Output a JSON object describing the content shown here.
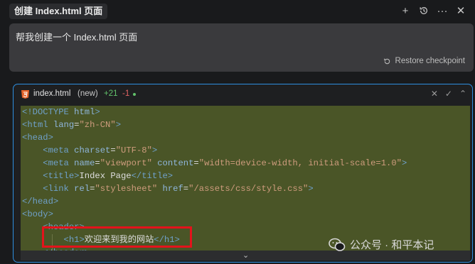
{
  "header": {
    "tab_title": "创建 Index.html 页面",
    "actions": [
      "plus-icon",
      "history-icon",
      "more-icon",
      "close-icon"
    ]
  },
  "prompt": {
    "text": "帮我创建一个 Index.html 页面",
    "restore_label": "Restore checkpoint"
  },
  "file": {
    "name": "index.html",
    "status": "(new)",
    "added": "+21",
    "removed": "-1"
  },
  "code_lines": [
    [
      {
        "c": "tg",
        "t": "<!DOCTYPE "
      },
      {
        "c": "attr",
        "t": "html"
      },
      {
        "c": "tg",
        "t": ">"
      }
    ],
    [
      {
        "c": "tg",
        "t": "<html "
      },
      {
        "c": "attr",
        "t": "lang"
      },
      {
        "c": "txt",
        "t": "="
      },
      {
        "c": "str",
        "t": "\"zh-CN\""
      },
      {
        "c": "tg",
        "t": ">"
      }
    ],
    [
      {
        "c": "tg",
        "t": "<head>"
      }
    ],
    [
      {
        "c": "txt",
        "t": "    "
      },
      {
        "c": "tg",
        "t": "<meta "
      },
      {
        "c": "attr",
        "t": "charset"
      },
      {
        "c": "txt",
        "t": "="
      },
      {
        "c": "str",
        "t": "\"UTF-8\""
      },
      {
        "c": "tg",
        "t": ">"
      }
    ],
    [
      {
        "c": "txt",
        "t": "    "
      },
      {
        "c": "tg",
        "t": "<meta "
      },
      {
        "c": "attr",
        "t": "name"
      },
      {
        "c": "txt",
        "t": "="
      },
      {
        "c": "str",
        "t": "\"viewport\""
      },
      {
        "c": "txt",
        "t": " "
      },
      {
        "c": "attr",
        "t": "content"
      },
      {
        "c": "txt",
        "t": "="
      },
      {
        "c": "str",
        "t": "\"width=device-width, initial-scale=1.0\""
      },
      {
        "c": "tg",
        "t": ">"
      }
    ],
    [
      {
        "c": "txt",
        "t": "    "
      },
      {
        "c": "tg",
        "t": "<title>"
      },
      {
        "c": "txt",
        "t": "Index Page"
      },
      {
        "c": "tg",
        "t": "</title>"
      }
    ],
    [
      {
        "c": "txt",
        "t": "    "
      },
      {
        "c": "tg",
        "t": "<link "
      },
      {
        "c": "attr",
        "t": "rel"
      },
      {
        "c": "txt",
        "t": "="
      },
      {
        "c": "str",
        "t": "\"stylesheet\""
      },
      {
        "c": "txt",
        "t": " "
      },
      {
        "c": "attr",
        "t": "href"
      },
      {
        "c": "txt",
        "t": "="
      },
      {
        "c": "str",
        "t": "\"/assets/css/style.css\""
      },
      {
        "c": "tg",
        "t": ">"
      }
    ],
    [
      {
        "c": "tg",
        "t": "</head>"
      }
    ],
    [
      {
        "c": "tg",
        "t": "<body>"
      }
    ],
    [
      {
        "c": "txt",
        "t": "    "
      },
      {
        "c": "tg",
        "t": "<header>"
      }
    ],
    [
      {
        "c": "txt",
        "t": "        "
      },
      {
        "c": "tg",
        "t": "<h1>"
      },
      {
        "c": "txt",
        "t": "欢迎来到我的网站"
      },
      {
        "c": "tg",
        "t": "</h1>"
      }
    ],
    [
      {
        "c": "txt",
        "t": "    "
      },
      {
        "c": "tg",
        "t": "</header>"
      }
    ]
  ],
  "watermark": {
    "text": "公众号 · 和平本记"
  },
  "colors": {
    "accent": "#2e8fe0",
    "added": "#62c26b",
    "removed": "#e26464",
    "highlight": "#e4131b",
    "diff_bg": "#4a5527"
  }
}
